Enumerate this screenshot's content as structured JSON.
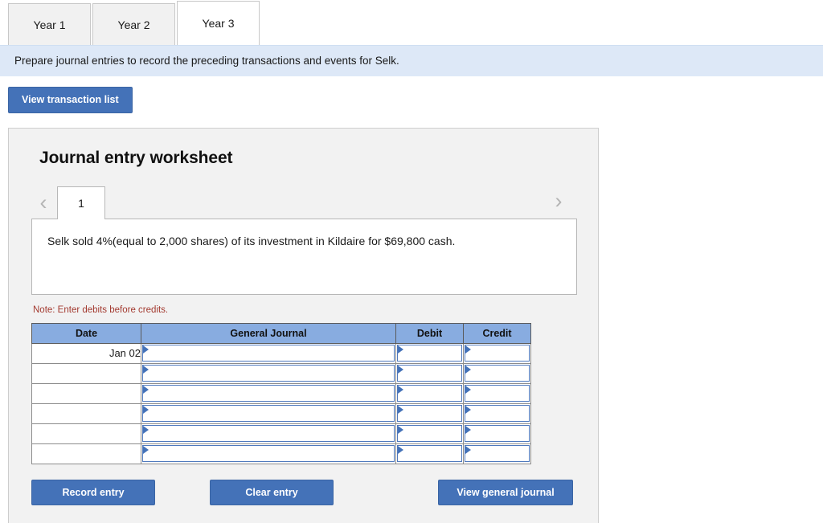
{
  "tabs": [
    {
      "label": "Year 1",
      "active": false
    },
    {
      "label": "Year 2",
      "active": false
    },
    {
      "label": "Year 3",
      "active": true
    }
  ],
  "instruction": "Prepare journal entries to record the preceding transactions and events for Selk.",
  "toolbar": {
    "view_transaction_list_label": "View transaction list"
  },
  "worksheet": {
    "title": "Journal entry worksheet",
    "prev_icon": "chevron-left-icon",
    "next_icon": "chevron-right-icon",
    "entry_tabs": [
      {
        "label": "1",
        "active": true
      }
    ],
    "transaction_description": "Selk sold 4%(equal to 2,000 shares) of its investment in Kildaire for $69,800 cash.",
    "note": "Note: Enter debits before credits.",
    "table": {
      "columns": [
        "Date",
        "General Journal",
        "Debit",
        "Credit"
      ],
      "rows": [
        {
          "date": "Jan 02",
          "general_journal": "",
          "debit": "",
          "credit": ""
        },
        {
          "date": "",
          "general_journal": "",
          "debit": "",
          "credit": ""
        },
        {
          "date": "",
          "general_journal": "",
          "debit": "",
          "credit": ""
        },
        {
          "date": "",
          "general_journal": "",
          "debit": "",
          "credit": ""
        },
        {
          "date": "",
          "general_journal": "",
          "debit": "",
          "credit": ""
        },
        {
          "date": "",
          "general_journal": "",
          "debit": "",
          "credit": ""
        }
      ]
    },
    "buttons": {
      "record_entry": "Record entry",
      "clear_entry": "Clear entry",
      "view_general_journal": "View general journal"
    }
  },
  "colors": {
    "button_blue": "#4472b8",
    "table_header_blue": "#88ace0",
    "instruction_bg": "#dde8f7",
    "panel_bg": "#f2f2f2",
    "note_red": "#a33a30"
  }
}
